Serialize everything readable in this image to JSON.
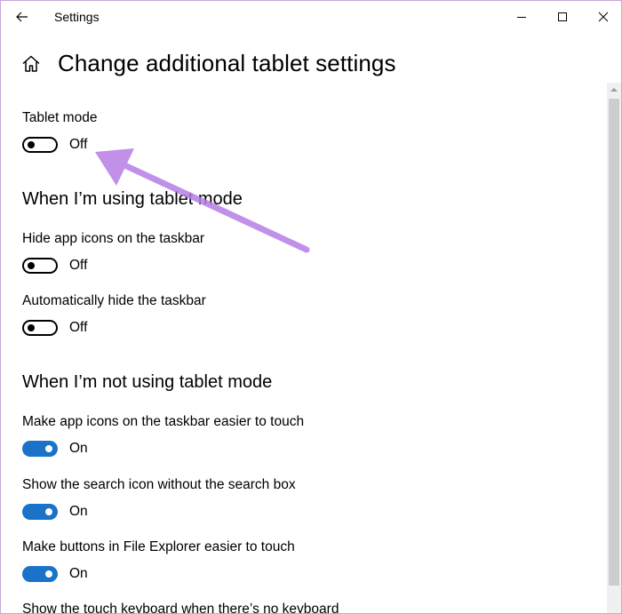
{
  "window": {
    "title": "Settings"
  },
  "page": {
    "title": "Change additional tablet settings"
  },
  "settings": {
    "tablet_mode": {
      "label": "Tablet mode",
      "state": "Off"
    }
  },
  "sections": {
    "using": {
      "title": "When I’m using tablet mode",
      "hide_icons": {
        "label": "Hide app icons on the taskbar",
        "state": "Off"
      },
      "auto_hide": {
        "label": "Automatically hide the taskbar",
        "state": "Off"
      }
    },
    "not_using": {
      "title": "When I’m not using tablet mode",
      "easier_touch": {
        "label": "Make app icons on the taskbar easier to touch",
        "state": "On"
      },
      "search_icon": {
        "label": "Show the search icon without the search box",
        "state": "On"
      },
      "file_explorer": {
        "label": "Make buttons in File Explorer easier to touch",
        "state": "On"
      },
      "touch_keyboard": {
        "label": "Show the touch keyboard when there’s no keyboard"
      }
    }
  },
  "colors": {
    "toggle_on": "#1a73c8",
    "annotation": "#b77de6"
  },
  "icons": {
    "back": "back-arrow-icon",
    "home": "home-icon",
    "minimize": "minimize-icon",
    "maximize": "maximize-icon",
    "close": "close-icon"
  }
}
